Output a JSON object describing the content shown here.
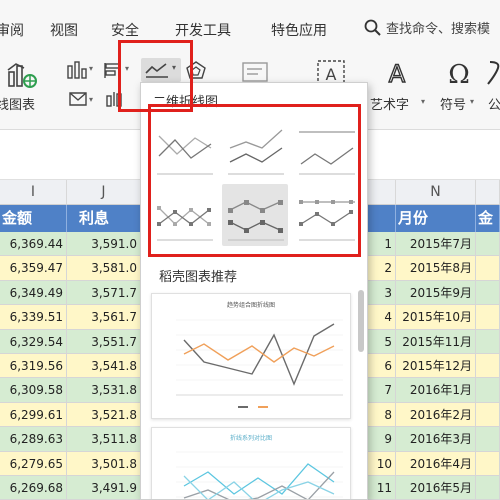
{
  "menu": {
    "items": [
      "审阅",
      "视图",
      "安全",
      "开发工具",
      "特色应用"
    ],
    "search_text": "查找命令、搜索模"
  },
  "ribbon": {
    "combo_chart_label": "线图表",
    "art_text_label": "艺术字",
    "symbol_label": "符号",
    "formula_label": "公"
  },
  "dropdown": {
    "title": "二维折线图",
    "recommend_title": "稻壳图表推荐",
    "rec_chart1_title": "趋势组合图折线图",
    "rec_chart2_title": "折线系列对比图"
  },
  "columns": {
    "headers": [
      "I",
      "J",
      "N"
    ],
    "row_headers": [
      "金额",
      "利息",
      "月份",
      "金"
    ]
  },
  "rows": [
    {
      "amount": "6,369.44",
      "interest": "3,591.0",
      "num": "1",
      "month": "2015年7月"
    },
    {
      "amount": "6,359.47",
      "interest": "3,581.0",
      "num": "2",
      "month": "2015年8月"
    },
    {
      "amount": "6,349.49",
      "interest": "3,571.7",
      "num": "3",
      "month": "2015年9月"
    },
    {
      "amount": "6,339.51",
      "interest": "3,561.7",
      "num": "4",
      "month": "2015年10月"
    },
    {
      "amount": "6,329.54",
      "interest": "3,551.7",
      "num": "5",
      "month": "2015年11月"
    },
    {
      "amount": "6,319.56",
      "interest": "3,541.8",
      "num": "6",
      "month": "2015年12月"
    },
    {
      "amount": "6,309.58",
      "interest": "3,531.8",
      "num": "7",
      "month": "2016年1月"
    },
    {
      "amount": "6,299.61",
      "interest": "3,521.8",
      "num": "8",
      "month": "2016年2月"
    },
    {
      "amount": "6,289.63",
      "interest": "3,511.8",
      "num": "9",
      "month": "2016年3月"
    },
    {
      "amount": "6,279.65",
      "interest": "3,501.8",
      "num": "10",
      "month": "2016年4月"
    },
    {
      "amount": "6,269.68",
      "interest": "3,491.9",
      "num": "11",
      "month": "2016年5月"
    }
  ],
  "colors": {
    "header_blue": "#4f81c7",
    "row_green": "#d6ecd2",
    "row_yellow": "#fff7c8",
    "highlight_red": "#e0201c"
  }
}
